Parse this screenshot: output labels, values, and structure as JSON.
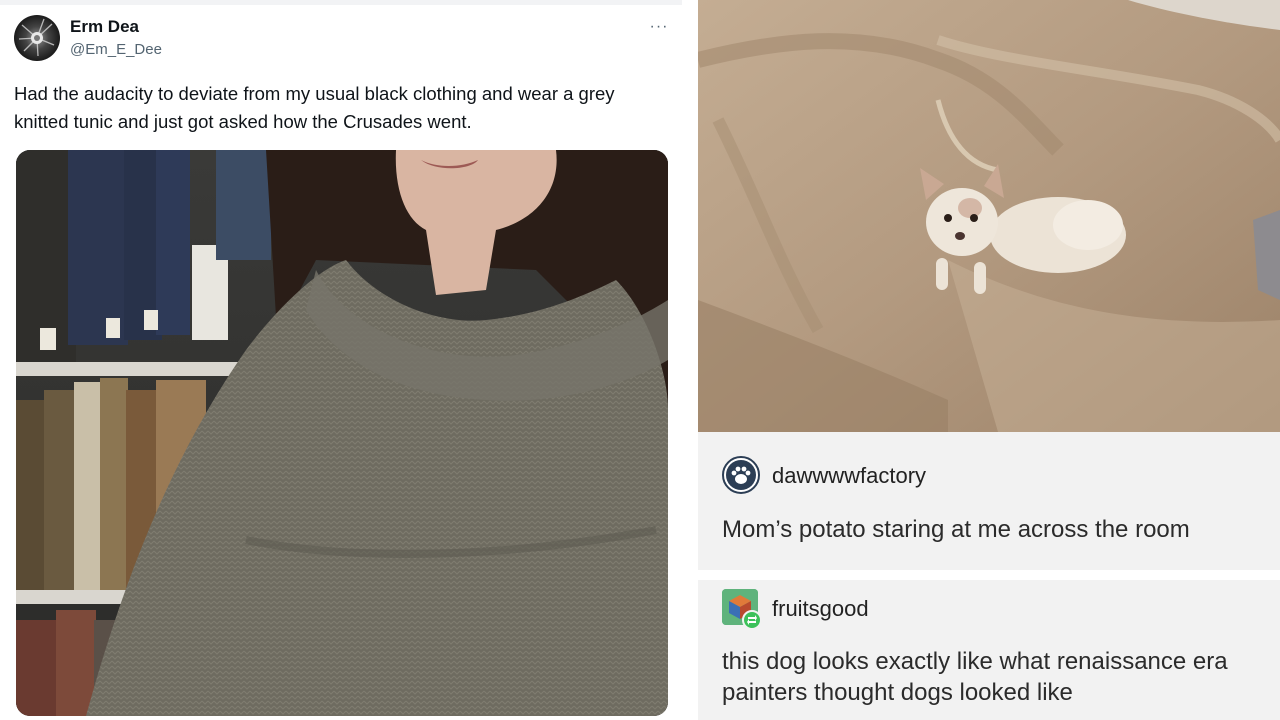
{
  "tweet": {
    "display_name": "Erm Dea",
    "handle": "@Em_E_Dee",
    "more_label": "···",
    "text": "Had the audacity to deviate from my usual black clothing and wear a grey knitted tunic and just got asked how the Crusades went.",
    "photo_icon": "photo-of-person-in-grey-knitted-tunic-in-library"
  },
  "tumblr": {
    "photo_icon": "photo-of-small-white-chihuahua-on-beige-couch",
    "post1": {
      "blog": "dawwwwfactory",
      "avatar_icon": "paw-icon",
      "text": "Mom’s potato staring at me across the room"
    },
    "post2": {
      "blog": "fruitsgood",
      "avatar_icon": "cube-icon",
      "reblog_icon": "reblog-icon",
      "text": "this dog looks exactly like what renaissance era painters thought dogs looked like"
    }
  },
  "colors": {
    "tweet_text": "#0f1419",
    "tweet_secondary": "#536471",
    "post_background": "#f2f2f2",
    "post_text": "#2b2b2b"
  }
}
